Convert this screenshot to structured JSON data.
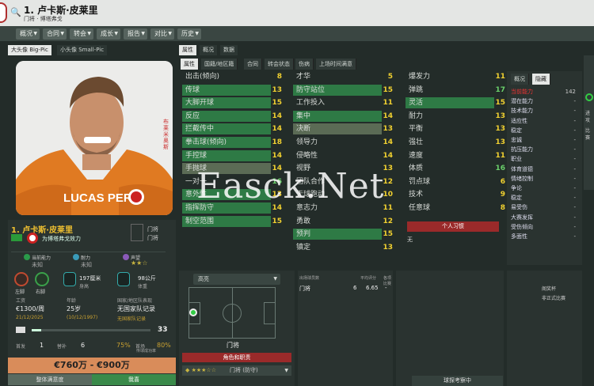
{
  "header": {
    "title": "1. 卢卡斯·皮莱里",
    "subtitle": "门将 · 博塔弗戈"
  },
  "nav": [
    {
      "label": "概况"
    },
    {
      "label": "合同"
    },
    {
      "label": "转会"
    },
    {
      "label": "成长"
    },
    {
      "label": "报告"
    },
    {
      "label": "对比"
    },
    {
      "label": "历史"
    }
  ],
  "photo_tabs": [
    {
      "label": "大头像 Big-Pic",
      "active": true
    },
    {
      "label": "小头像 Small-Pic",
      "active": false
    }
  ],
  "photo": {
    "shirt_text": "LUCAS PERRI",
    "side_text": "布莱米奥斯"
  },
  "card": {
    "name": "1. 卢卡斯·皮莱里",
    "loan": "为博塔弗戈效力",
    "pos_lines": [
      "门将",
      "门将"
    ],
    "ability_label": "当前能力",
    "ability_val": "未知",
    "cond_label": "耐力",
    "cond_val": "未知",
    "rep_label": "声望",
    "foot_left": "左脚",
    "foot_right": "右脚",
    "height": "197厘米",
    "height_label": "身高",
    "weight": "98公斤",
    "weight_label": "体重",
    "wage_label": "工资",
    "wage": "€1300/周",
    "age_label": "年龄",
    "age": "25岁",
    "contract_label": "国家/地区队表现",
    "contract": "无国家队记录",
    "date": "21/12/2025",
    "dob": "(10/12/1997)",
    "intl": "无国家队记录",
    "bar_val": "33",
    "stats": [
      "首发",
      "1",
      "替补",
      "6",
      "75%",
      "首场",
      "传球成功率",
      "80%"
    ],
    "value": "€760万 - €900万",
    "value_label": "整体满意度",
    "value_btn": "我喜"
  },
  "attr_tabs": [
    {
      "label": "属性",
      "active": true
    },
    {
      "label": "概况",
      "active": false
    },
    {
      "label": "数据",
      "active": false
    }
  ],
  "sub_tabs": [
    {
      "label": "属性",
      "active": true
    },
    {
      "label": "国籍/地区籍",
      "active": false
    },
    {
      "label": "合同",
      "active": false
    },
    {
      "label": "转会状态",
      "active": false
    },
    {
      "label": "伤病",
      "active": false
    },
    {
      "label": "上场时间满意",
      "active": false
    }
  ],
  "attrs_col1": [
    {
      "n": "出击(倾向)",
      "v": "8",
      "c": ""
    },
    {
      "n": "传球",
      "v": "13",
      "c": "hl"
    },
    {
      "n": "大脚开球",
      "v": "15",
      "c": "hl"
    },
    {
      "n": "反应",
      "v": "14",
      "c": "hl"
    },
    {
      "n": "拦截传中",
      "v": "14",
      "c": "hl"
    },
    {
      "n": "拳击球(倾向)",
      "v": "18",
      "c": "hl"
    },
    {
      "n": "手控球",
      "v": "14",
      "c": "hl"
    },
    {
      "n": "手抛球",
      "v": "14",
      "c": "hl3"
    },
    {
      "n": "一对一",
      "v": "16",
      "c": ""
    },
    {
      "n": "意外性",
      "v": "13",
      "c": "hl"
    },
    {
      "n": "指挥防守",
      "v": "14",
      "c": "hl"
    },
    {
      "n": "制空范围",
      "v": "15",
      "c": "hl"
    }
  ],
  "attrs_col2": [
    {
      "n": "才华",
      "v": "5",
      "c": ""
    },
    {
      "n": "防守站位",
      "v": "15",
      "c": "hl"
    },
    {
      "n": "工作投入",
      "v": "11",
      "c": ""
    },
    {
      "n": "集中",
      "v": "14",
      "c": "hl"
    },
    {
      "n": "决断",
      "v": "13",
      "c": "hl3"
    },
    {
      "n": "领导力",
      "v": "14",
      "c": ""
    },
    {
      "n": "侵略性",
      "v": "14",
      "c": ""
    },
    {
      "n": "视野",
      "v": "13",
      "c": ""
    },
    {
      "n": "团队合作",
      "v": "12",
      "c": ""
    },
    {
      "n": "无球跑动",
      "v": "10",
      "c": ""
    },
    {
      "n": "意志力",
      "v": "11",
      "c": ""
    },
    {
      "n": "勇敢",
      "v": "12",
      "c": ""
    },
    {
      "n": "预判",
      "v": "15",
      "c": "hl"
    },
    {
      "n": "镇定",
      "v": "13",
      "c": ""
    }
  ],
  "attrs_col3": [
    {
      "n": "爆发力",
      "v": "11",
      "c": ""
    },
    {
      "n": "弹跳",
      "v": "17",
      "c": ""
    },
    {
      "n": "灵活",
      "v": "15",
      "c": "hl"
    },
    {
      "n": "耐力",
      "v": "13",
      "c": ""
    },
    {
      "n": "平衡",
      "v": "13",
      "c": ""
    },
    {
      "n": "强壮",
      "v": "13",
      "c": ""
    },
    {
      "n": "速度",
      "v": "11",
      "c": ""
    },
    {
      "n": "体质",
      "v": "16",
      "c": ""
    },
    {
      "n": "罚点球",
      "v": "6",
      "c": ""
    },
    {
      "n": "技术",
      "v": "9",
      "c": ""
    },
    {
      "n": "任意球",
      "v": "8",
      "c": ""
    }
  ],
  "traits_btn": "个人习惯",
  "traits_none": "无",
  "right_tabs": [
    {
      "label": "概况",
      "active": false
    },
    {
      "label": "隐藏",
      "active": true
    }
  ],
  "hidden": [
    {
      "n": "当前能力",
      "v": "142"
    },
    {
      "n": "潜在能力",
      "v": "-"
    },
    {
      "n": "技术能力",
      "v": "-"
    },
    {
      "n": "适应性",
      "v": "-"
    },
    {
      "n": "稳定",
      "v": "-"
    },
    {
      "n": "忠诚",
      "v": "-"
    },
    {
      "n": "抗压能力",
      "v": "-"
    },
    {
      "n": "职业",
      "v": "-"
    },
    {
      "n": "体育道德",
      "v": "-"
    },
    {
      "n": "情绪控制",
      "v": "-"
    },
    {
      "n": "争论",
      "v": "-"
    },
    {
      "n": "稳定",
      "v": "-"
    },
    {
      "n": "易受伤",
      "v": "-"
    },
    {
      "n": "大赛发挥",
      "v": "-"
    },
    {
      "n": "受伤倾向",
      "v": "-"
    },
    {
      "n": "多面性",
      "v": "-"
    }
  ],
  "far_right": {
    "a": "进攻",
    "b": "比赛"
  },
  "bottom": {
    "dropdown": "高亮",
    "role_btn": "角色和职责",
    "pos": "门将",
    "role_line": "门将 (防守)",
    "stats_headers": [
      "出场球员数",
      "平均评分",
      "各项比赛"
    ],
    "stats_row": [
      "门将",
      "6",
      "6.65",
      "-"
    ],
    "right_lines": [
      "阁奖杯",
      "非正式比赛"
    ],
    "scout": "球探考察中"
  }
}
